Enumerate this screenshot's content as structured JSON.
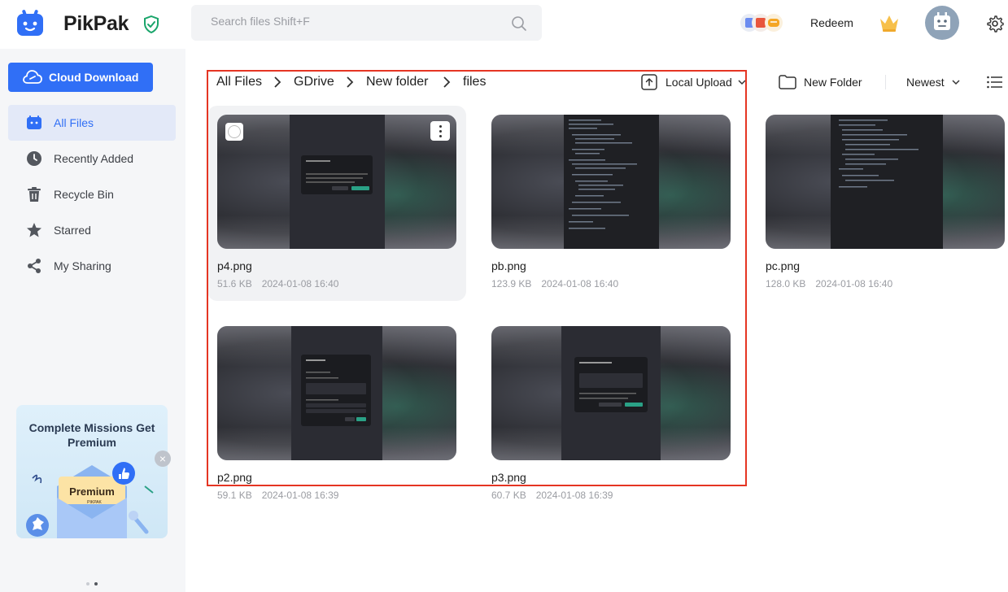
{
  "app": {
    "name": "PikPak"
  },
  "search": {
    "placeholder": "Search files Shift+F"
  },
  "header": {
    "redeem_label": "Redeem"
  },
  "sidebar": {
    "cloud_download_label": "Cloud Download",
    "items": [
      {
        "label": "All Files",
        "icon": "folder-icon",
        "active": true
      },
      {
        "label": "Recently Added",
        "icon": "clock-icon",
        "active": false
      },
      {
        "label": "Recycle Bin",
        "icon": "trash-icon",
        "active": false
      },
      {
        "label": "Starred",
        "icon": "star-icon",
        "active": false
      },
      {
        "label": "My Sharing",
        "icon": "share-icon",
        "active": false
      }
    ],
    "promo": {
      "title": "Complete Missions Get Premium",
      "art_text": "Premium",
      "art_sub": "PIKPAK"
    }
  },
  "breadcrumb": [
    "All Files",
    "GDrive",
    "New folder",
    "files"
  ],
  "toolbar": {
    "local_upload_label": "Local Upload",
    "new_folder_label": "New Folder",
    "sort_label": "Newest"
  },
  "files": [
    {
      "name": "p4.png",
      "size": "51.6 KB",
      "date": "2024-01-08 16:40"
    },
    {
      "name": "pb.png",
      "size": "123.9 KB",
      "date": "2024-01-08 16:40"
    },
    {
      "name": "pc.png",
      "size": "128.0 KB",
      "date": "2024-01-08 16:40"
    },
    {
      "name": "p2.png",
      "size": "59.1 KB",
      "date": "2024-01-08 16:39"
    },
    {
      "name": "p3.png",
      "size": "60.7 KB",
      "date": "2024-01-08 16:39"
    }
  ],
  "colors": {
    "accent": "#306ff6",
    "highlight_frame": "#e53523",
    "shield_green": "#1aa56b"
  }
}
